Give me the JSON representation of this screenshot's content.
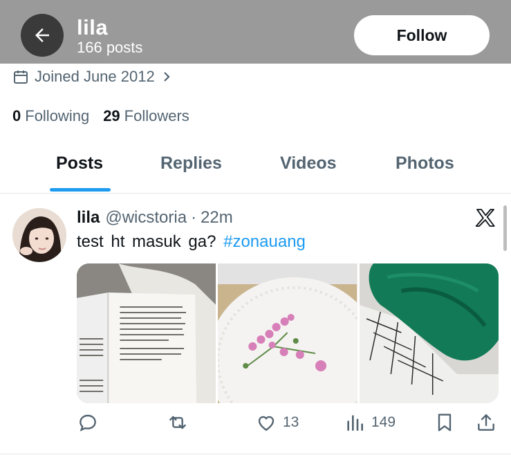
{
  "header": {
    "name": "lila",
    "post_count": "166 posts",
    "follow_label": "Follow"
  },
  "profile": {
    "joined": "Joined June 2012",
    "following_count": "0",
    "following_label": "Following",
    "followers_count": "29",
    "followers_label": "Followers"
  },
  "tabs": [
    {
      "label": "Posts",
      "active": true
    },
    {
      "label": "Replies",
      "active": false
    },
    {
      "label": "Videos",
      "active": false
    },
    {
      "label": "Photos",
      "active": false
    }
  ],
  "post": {
    "name": "lila",
    "handle": "@wicstoria",
    "separator": "·",
    "time": "22m",
    "text": "test ht masuk ga?",
    "hashtag": "#zonauang",
    "actions": {
      "reply_count": "",
      "repost_count": "",
      "like_count": "13",
      "views_count": "149"
    }
  },
  "colors": {
    "header_bg": "#9a9a9a",
    "accent": "#1d9bf0",
    "muted_text": "#536471",
    "primary_text": "#0f1419"
  },
  "icons": [
    "back-arrow-icon",
    "calendar-icon",
    "chevron-right-icon",
    "x-logo-icon",
    "reply-icon",
    "repost-icon",
    "like-icon",
    "views-icon",
    "bookmark-icon",
    "share-icon"
  ]
}
